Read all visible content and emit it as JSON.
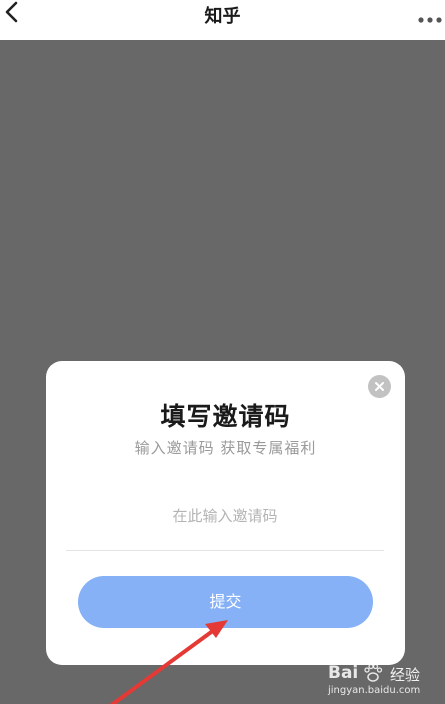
{
  "header": {
    "title": "知乎",
    "back_icon": "chevron-left-icon",
    "more_icon": "more-dots-icon"
  },
  "dialog": {
    "title": "填写邀请码",
    "subtitle": "输入邀请码 获取专属福利",
    "input": {
      "placeholder": "在此输入邀请码",
      "value": ""
    },
    "submit_label": "提交",
    "close_icon": "close-icon"
  },
  "watermark": {
    "logo": "Bai",
    "title": "经验",
    "domain": "jingyan.baidu.com"
  },
  "colors": {
    "backdrop": "#686868",
    "button": "#86b1f6",
    "arrow": "#e53935"
  }
}
